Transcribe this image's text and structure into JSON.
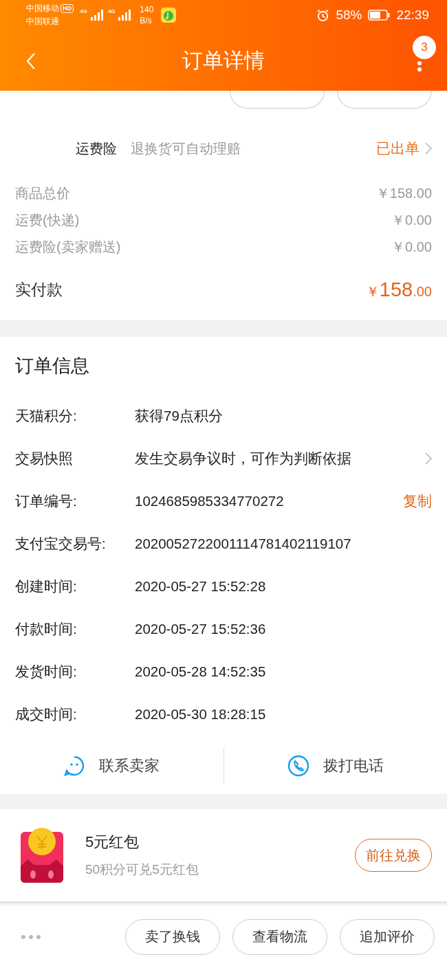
{
  "status_bar": {
    "carriers": [
      "中国移动",
      "中国联通"
    ],
    "hd": "HD",
    "networks": [
      "4G",
      "4G"
    ],
    "speed": [
      "140",
      "B/s"
    ],
    "battery": "58%",
    "time": "22:39"
  },
  "header": {
    "title": "订单详情",
    "badge": "3"
  },
  "insurance": {
    "name": "运费险",
    "description": "退换货可自动理赔",
    "status": "已出单"
  },
  "prices": [
    {
      "label": "商品总价",
      "value": "￥158.00"
    },
    {
      "label": "运费(快递)",
      "value": "￥0.00"
    },
    {
      "label": "运费险(卖家赠送)",
      "value": "￥0.00"
    }
  ],
  "paid": {
    "label": "实付款",
    "currency": "￥",
    "integer": "158",
    "decimal": ".00"
  },
  "order_info": {
    "title": "订单信息",
    "rows": [
      {
        "kind": "plain",
        "label": "天猫积分:",
        "value": "获得79点积分"
      },
      {
        "kind": "link",
        "label": "交易快照",
        "value": "发生交易争议时，可作为判断依据"
      },
      {
        "kind": "copy",
        "label": "订单编号:",
        "value": "1024685985334770272",
        "action": "复制"
      },
      {
        "kind": "plain",
        "label": "支付宝交易号:",
        "value": "2020052722001114781402119107"
      },
      {
        "kind": "plain",
        "label": "创建时间:",
        "value": "2020-05-27 15:52:28"
      },
      {
        "kind": "plain",
        "label": "付款时间:",
        "value": "2020-05-27 15:52:36"
      },
      {
        "kind": "plain",
        "label": "发货时间:",
        "value": "2020-05-28 14:52:35"
      },
      {
        "kind": "plain",
        "label": "成交时间:",
        "value": "2020-05-30 18:28:15"
      }
    ]
  },
  "contact": [
    {
      "kind": "chat",
      "label": "联系卖家"
    },
    {
      "kind": "phone",
      "label": "拨打电话"
    }
  ],
  "promo": {
    "title": "5元红包",
    "subtitle": "50积分可兑5元红包",
    "button": "前往兑换"
  },
  "bottom_bar": {
    "buttons": [
      "卖了换钱",
      "查看物流",
      "追加评价"
    ]
  }
}
